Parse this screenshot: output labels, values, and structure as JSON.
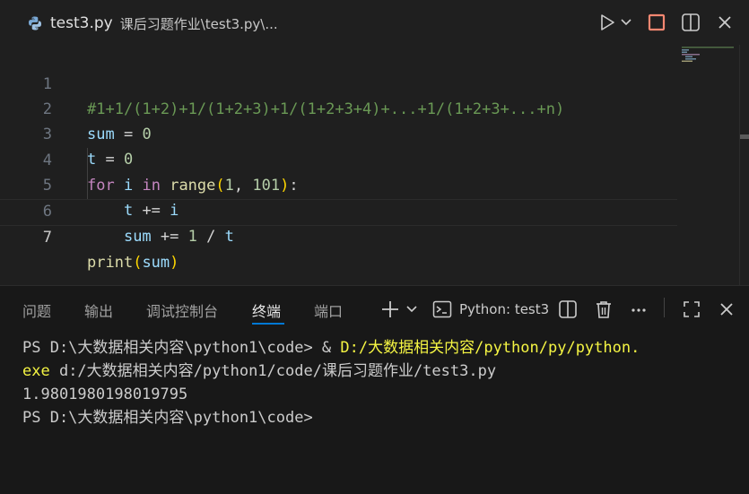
{
  "tab": {
    "filename": "test3.py",
    "path": "课后习题作业\\test3.py\\..."
  },
  "editor": {
    "line_numbers": [
      "1",
      "2",
      "3",
      "4",
      "5",
      "6",
      "7"
    ],
    "lines": {
      "l1": "#1+1/(1+2)+1/(1+2+3)+1/(1+2+3+4)+...+1/(1+2+3+...+n)",
      "l2": {
        "a": "sum",
        "b": " = ",
        "c": "0"
      },
      "l3": {
        "a": "t",
        "b": " = ",
        "c": "0"
      },
      "l4": {
        "a": "for",
        "b": " ",
        "c": "i",
        "d": " ",
        "e": "in",
        "f": " ",
        "g": "range",
        "h": "(",
        "i": "1",
        "j": ", ",
        "k": "101",
        "l": ")",
        "m": ":"
      },
      "l5": {
        "a": "    ",
        "b": "t",
        "c": " += ",
        "d": "i"
      },
      "l6": {
        "a": "    ",
        "b": "sum",
        "c": " += ",
        "d": "1",
        "e": " / ",
        "f": "t"
      },
      "l7": {
        "a": "print",
        "b": "(",
        "c": "sum",
        "d": ")"
      }
    }
  },
  "panel": {
    "tabs": [
      "问题",
      "输出",
      "调试控制台",
      "终端",
      "端口"
    ],
    "active_tab": "终端",
    "terminal_name": "Python: test3"
  },
  "terminal": {
    "line1_a": "PS D:\\大数据相关内容\\python1\\code> & ",
    "line1_b": "D:/大数据相关内容/python/py/python.",
    "line2_a": "exe",
    "line2_b": " d:/大数据相关内容/python1/code/课后习题作业/test3.py",
    "line3": "1.9801980198019795",
    "line4": "PS D:\\大数据相关内容\\python1\\code>"
  },
  "colors": {
    "accent": "#0078d4",
    "stop": "#f48771",
    "background": "#1f1f1f"
  }
}
